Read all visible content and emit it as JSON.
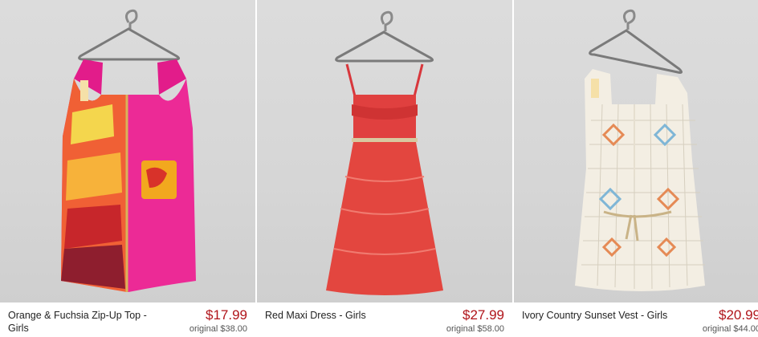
{
  "products": [
    {
      "name": "Orange & Fuchsia Zip-Up Top - Girls",
      "price": "$17.99",
      "original": "original $38.00"
    },
    {
      "name": "Red Maxi Dress - Girls",
      "price": "$27.99",
      "original": "original $58.00"
    },
    {
      "name": "Ivory Country Sunset Vest - Girls",
      "price": "$20.99",
      "original": "original $44.00"
    }
  ],
  "colors": {
    "price": "#b0141a",
    "background": "#d8d8d8"
  }
}
